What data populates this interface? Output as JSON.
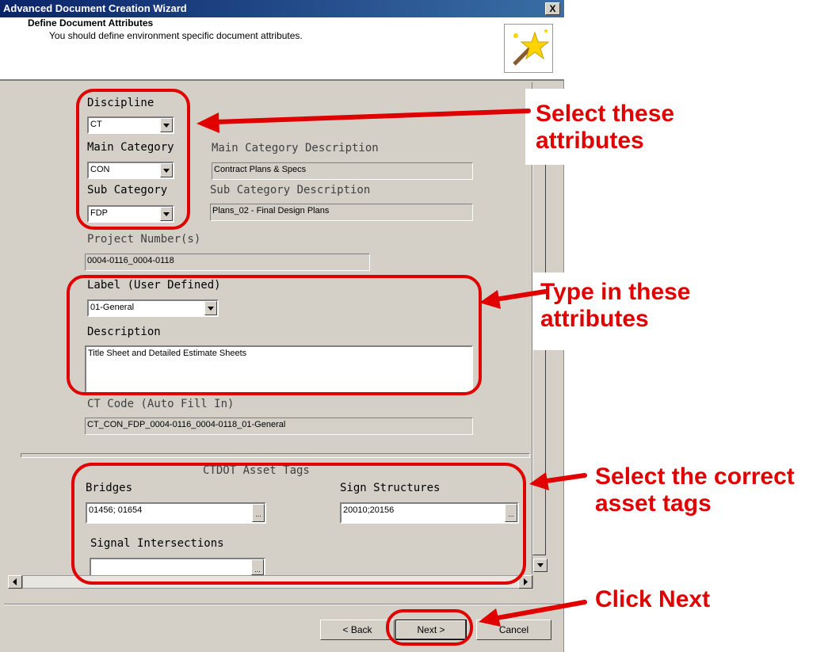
{
  "window": {
    "title": "Advanced Document Creation Wizard",
    "close_glyph": "X"
  },
  "header": {
    "title": "Define Document Attributes",
    "subtitle": "You should define environment specific document attributes."
  },
  "form": {
    "discipline": {
      "label": "Discipline",
      "value": "CT"
    },
    "main_category": {
      "label": "Main Category",
      "value": "CON"
    },
    "main_category_desc": {
      "label": "Main Category Description",
      "value": "Contract Plans & Specs"
    },
    "sub_category": {
      "label": "Sub Category",
      "value": "FDP"
    },
    "sub_category_desc": {
      "label": "Sub Category Description",
      "value": "Plans_02 - Final Design Plans"
    },
    "project_numbers": {
      "label": "Project Number(s)",
      "value": "0004-0116_0004-0118"
    },
    "user_label": {
      "label": "Label (User Defined)",
      "value": "01-General"
    },
    "description": {
      "label": "Description",
      "value": "Title Sheet and Detailed Estimate Sheets"
    },
    "ct_code": {
      "label": "CT Code (Auto Fill In)",
      "value": "CT_CON_FDP_0004-0116_0004-0118_01-General"
    }
  },
  "asset_tags": {
    "title": "CTDOT Asset Tags",
    "bridges": {
      "label": "Bridges",
      "value": "01456; 01654"
    },
    "sign_structures": {
      "label": "Sign Structures",
      "value": "20010;20156"
    },
    "signal_intersections": {
      "label": "Signal Intersections",
      "value": ""
    },
    "browse_glyph": "..."
  },
  "buttons": {
    "back": "< Back",
    "next": "Next >",
    "cancel": "Cancel"
  },
  "annotations": {
    "select_attrs": [
      "Select these",
      "attributes"
    ],
    "type_attrs": [
      "Type in these",
      "attributes"
    ],
    "asset_tags": [
      "Select the correct",
      "asset tags"
    ],
    "click_next": "Click Next"
  },
  "colors": {
    "annotation": "#e00000",
    "titlebar": "#0a246a",
    "dialog": "#d4d0c8"
  }
}
